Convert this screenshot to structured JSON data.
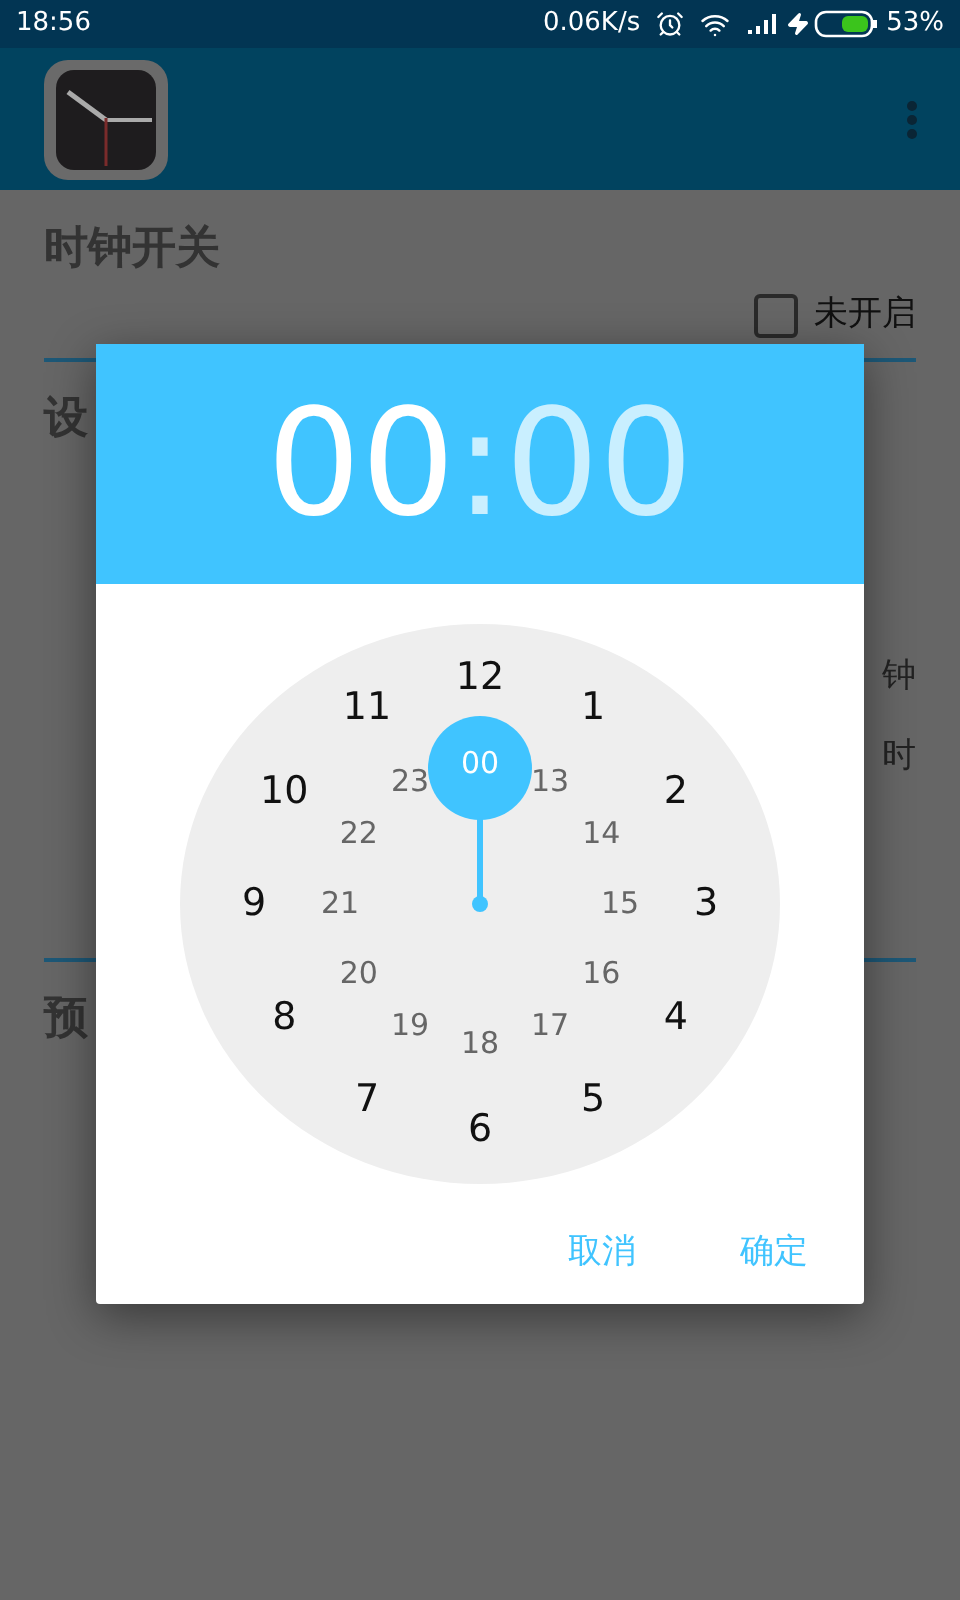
{
  "status_bar": {
    "time": "18:56",
    "speed": "0.06K/s",
    "battery": "53%"
  },
  "page": {
    "title": "时钟开关",
    "checkbox": {
      "label": "未开启",
      "checked": false
    },
    "fragments": [
      {
        "kind": "heading",
        "text": "设"
      },
      {
        "kind": "right",
        "text": "钟"
      },
      {
        "kind": "right",
        "text": "时"
      },
      {
        "kind": "divider"
      },
      {
        "kind": "heading",
        "text": "预"
      }
    ]
  },
  "dialog": {
    "hour": {
      "text": "00",
      "selected": true
    },
    "separator": ":",
    "minute": {
      "text": "00",
      "selected": false
    },
    "outer": [
      {
        "text": "12",
        "selected": false
      },
      {
        "text": "1",
        "selected": false
      },
      {
        "text": "2",
        "selected": false
      },
      {
        "text": "3",
        "selected": false
      },
      {
        "text": "4",
        "selected": false
      },
      {
        "text": "5",
        "selected": false
      },
      {
        "text": "6",
        "selected": false
      },
      {
        "text": "7",
        "selected": false
      },
      {
        "text": "8",
        "selected": false
      },
      {
        "text": "9",
        "selected": false
      },
      {
        "text": "10",
        "selected": false
      },
      {
        "text": "11",
        "selected": false
      }
    ],
    "inner": [
      {
        "text": "00",
        "selected": true
      },
      {
        "text": "13",
        "selected": false
      },
      {
        "text": "14",
        "selected": false
      },
      {
        "text": "15",
        "selected": false
      },
      {
        "text": "16",
        "selected": false
      },
      {
        "text": "17",
        "selected": false
      },
      {
        "text": "18",
        "selected": false
      },
      {
        "text": "19",
        "selected": false
      },
      {
        "text": "20",
        "selected": false
      },
      {
        "text": "21",
        "selected": false
      },
      {
        "text": "22",
        "selected": false
      },
      {
        "text": "23",
        "selected": false
      }
    ],
    "buttons": [
      "取消",
      "确定"
    ]
  }
}
